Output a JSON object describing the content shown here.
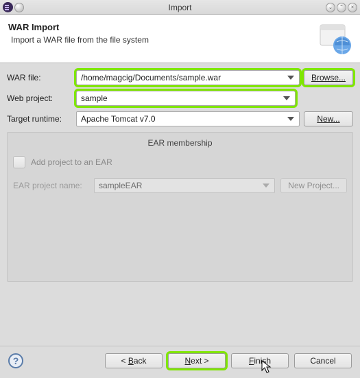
{
  "window": {
    "title": "Import"
  },
  "banner": {
    "heading": "WAR Import",
    "sub": "Import a WAR file from the file system"
  },
  "form": {
    "war_label": "WAR file:",
    "war_value": "/home/magcig/Documents/sample.war",
    "browse_label": "Browse...",
    "web_label": "Web project:",
    "web_value": "sample",
    "runtime_label": "Target runtime:",
    "runtime_value": "Apache Tomcat v7.0",
    "new_label": "New..."
  },
  "ear": {
    "group_title": "EAR membership",
    "add_label": "Add project to an EAR",
    "name_label": "EAR project name:",
    "name_value": "sampleEAR",
    "new_proj_label": "New Project..."
  },
  "footer": {
    "back": "< Back",
    "next": "Next >",
    "finish": "Finish",
    "cancel": "Cancel"
  }
}
